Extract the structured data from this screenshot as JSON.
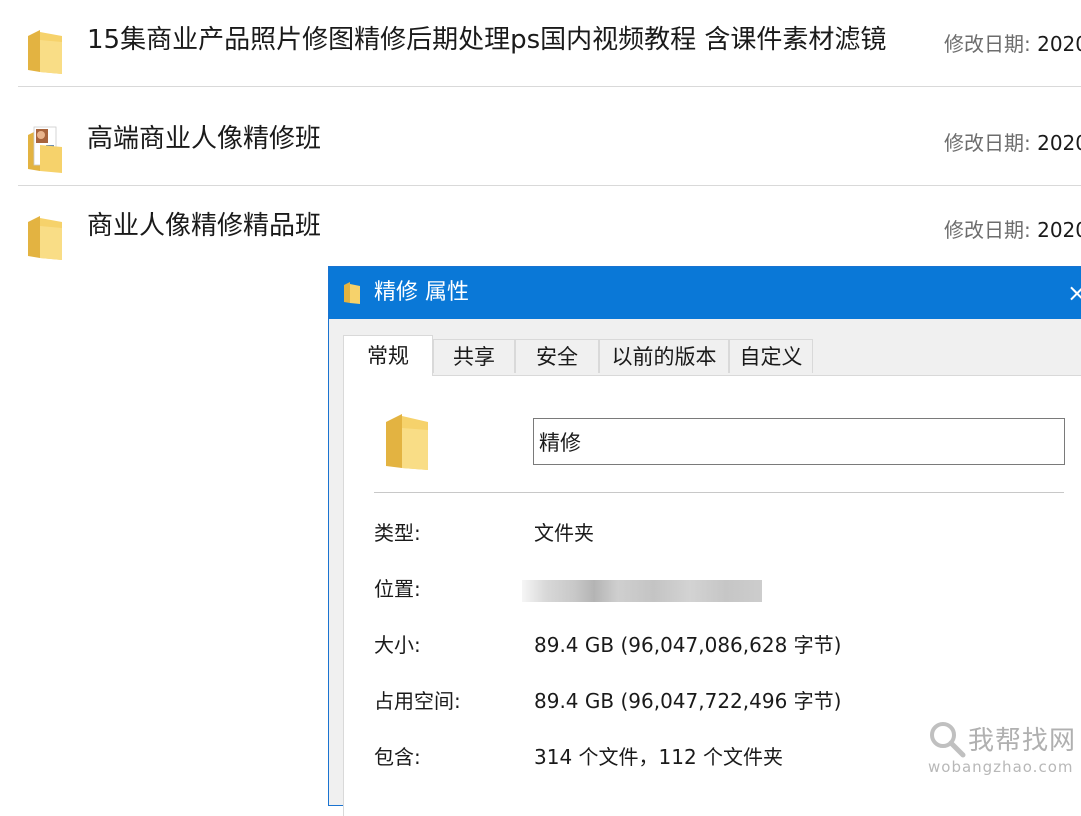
{
  "file_list": {
    "meta_label": "修改日期:",
    "items": [
      {
        "name": "15集商业产品照片修图精修后期处理ps国内视频教程 含课件素材滤镜",
        "date": "2020",
        "icon": "folder-icon"
      },
      {
        "name": "高端商业人像精修班",
        "date": "2020",
        "icon": "folder-thumbnail-icon"
      },
      {
        "name": "商业人像精修精品班",
        "date": "2020",
        "icon": "folder-icon"
      }
    ]
  },
  "dialog": {
    "title": "精修 属性",
    "close_glyph": "×",
    "tabs": [
      "常规",
      "共享",
      "安全",
      "以前的版本",
      "自定义"
    ],
    "active_tab": 0,
    "folder_name": "精修",
    "props": {
      "type_label": "类型:",
      "type_value": "文件夹",
      "location_label": "位置:",
      "size_label": "大小:",
      "size_value": "89.4 GB (96,047,086,628 字节)",
      "disk_label": "占用空间:",
      "disk_value": "89.4 GB (96,047,722,496 字节)",
      "contains_label": "包含:",
      "contains_value": "314 个文件，112 个文件夹"
    }
  },
  "watermark": {
    "text": "我帮找网",
    "url": "wobangzhao.com"
  },
  "colors": {
    "titlebar": "#0a78d7",
    "folder": "#f6d26b",
    "folder_dark": "#e3b341"
  }
}
